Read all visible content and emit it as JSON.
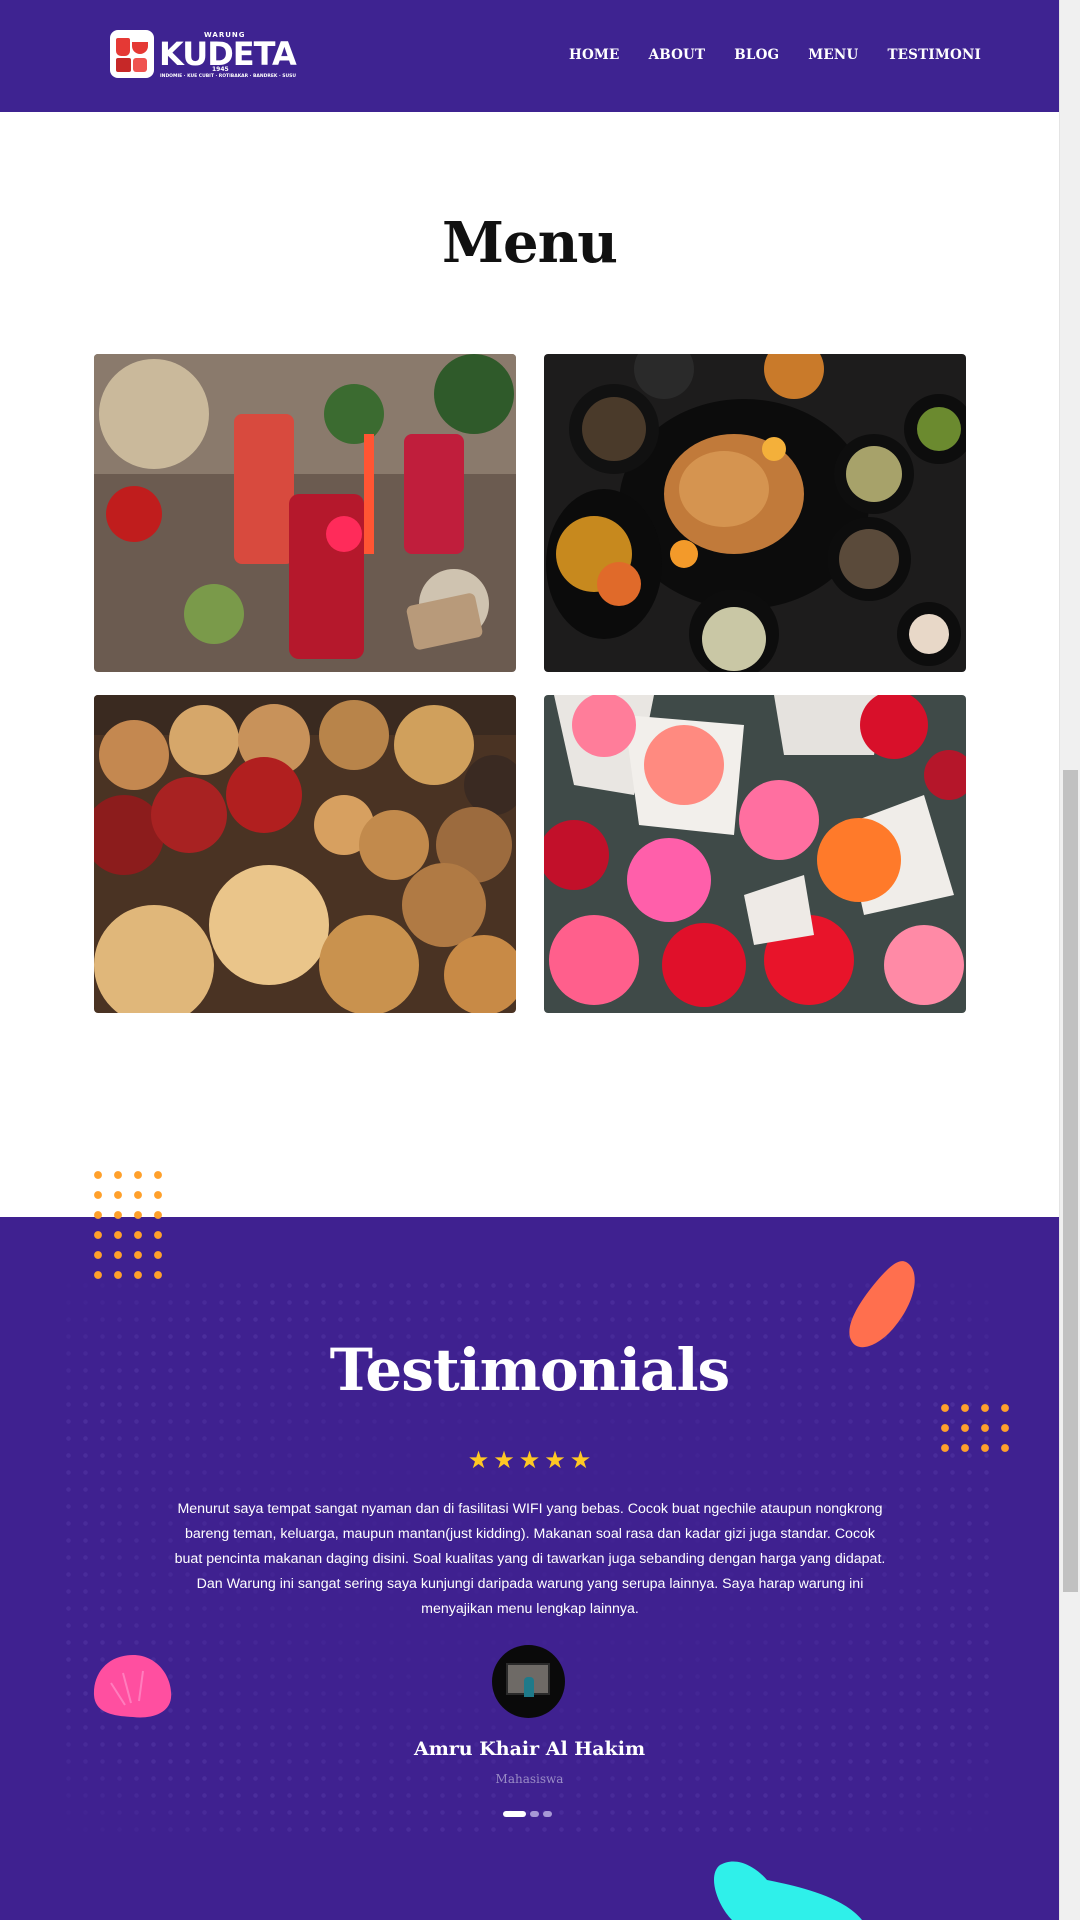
{
  "header": {
    "logo": {
      "name": "KUDETA",
      "small_top": "WARUNG",
      "year": "1945",
      "tagline": "INDOMIE · KUE CUBIT · ROTIBAKAR · BANDREK · SUSU"
    },
    "nav": [
      "HOME",
      "ABOUT",
      "BLOG",
      "MENU",
      "TESTIMONI"
    ]
  },
  "menu": {
    "title": "Menu",
    "items": [
      {
        "image": "red-drinks-photo"
      },
      {
        "image": "roast-chicken-spread-photo"
      },
      {
        "image": "pastries-cookies-photo"
      },
      {
        "image": "flower-bouquets-photo"
      }
    ]
  },
  "testimonials": {
    "title": "Testimonials",
    "rating": 5,
    "quote": "Menurut saya tempat sangat nyaman dan di fasilitasi WIFI yang bebas. Cocok buat ngechile ataupun nongkrong bareng teman, keluarga, maupun mantan(just kidding). Makanan soal rasa dan kadar gizi juga standar. Cocok buat pencinta makanan daging disini. Soal kualitas yang di tawarkan juga sebanding dengan harga yang didapat. Dan Warung ini sangat sering saya kunjungi daripada warung yang serupa lainnya. Saya harap warung ini menyajikan menu lengkap lainnya.",
    "author": "Amru Khair Al Hakim",
    "role": "Mahasiswa",
    "slides": 3,
    "active_slide": 1
  },
  "colors": {
    "brand_purple": "#3e2391",
    "star_yellow": "#ffc824",
    "accent_orange": "#ffa02b",
    "shape_coral": "#ff6f4e",
    "shape_pink": "#ff4fa0",
    "shape_cyan": "#2ff0ea"
  }
}
